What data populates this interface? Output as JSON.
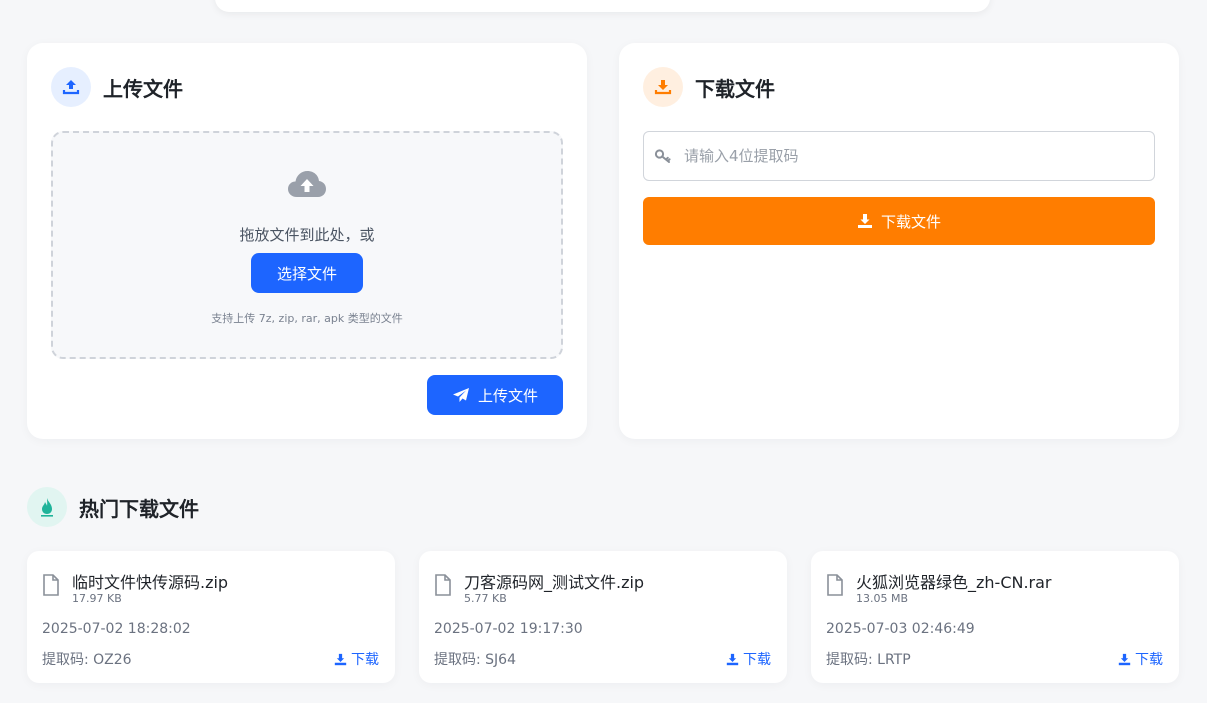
{
  "upload": {
    "title": "上传文件",
    "drop_text": "拖放文件到此处，或",
    "choose_button": "选择文件",
    "hint": "支持上传 7z, zip, rar, apk 类型的文件",
    "upload_button": "上传文件"
  },
  "download": {
    "title": "下载文件",
    "input_placeholder": "请输入4位提取码",
    "input_value": "",
    "button": "下载文件"
  },
  "hot": {
    "title": "热门下载文件",
    "files": [
      {
        "name": "临时文件快传源码.zip",
        "size": "17.97 KB",
        "date": "2025-07-02 18:28:02",
        "code": "提取码: OZ26",
        "download_label": "下载"
      },
      {
        "name": "刀客源码网_测试文件.zip",
        "size": "5.77 KB",
        "date": "2025-07-02 19:17:30",
        "code": "提取码: SJ64",
        "download_label": "下载"
      },
      {
        "name": "火狐浏览器绿色_zh-CN.rar",
        "size": "13.05 MB",
        "date": "2025-07-03 02:46:49",
        "code": "提取码: LRTP",
        "download_label": "下载"
      }
    ]
  },
  "colors": {
    "primary_blue": "#1d65ff",
    "accent_orange": "#ff7d00",
    "background": "#f6f7f9"
  }
}
